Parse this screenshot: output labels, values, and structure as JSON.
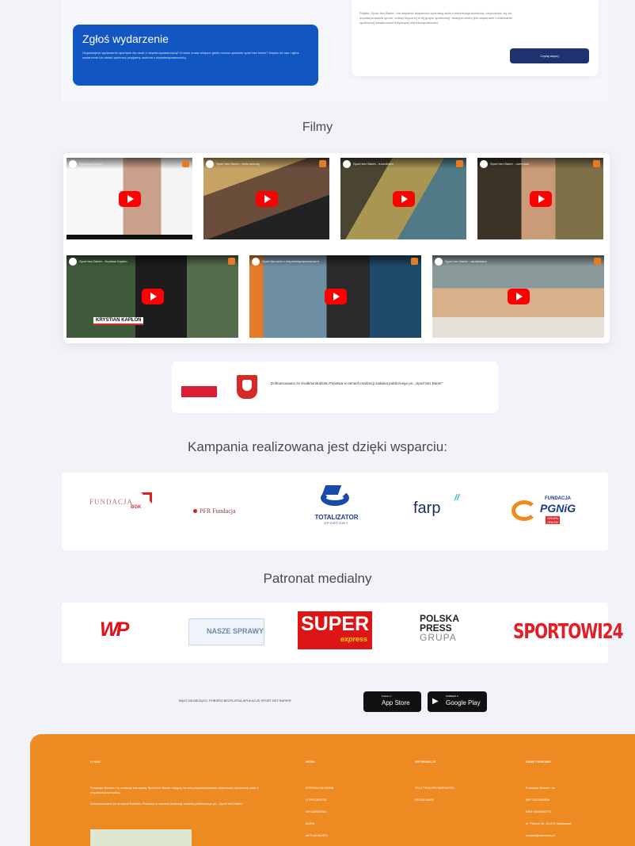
{
  "report_event": {
    "title": "Zgłoś wydarzenie",
    "text": "Organizujesz wydarzenie sportowe dla osób z niepełnosprawnością? A może znasz miejsce gdzie można uprawiać sport bez barier? Napisz do nas i zgłoś wydarzenie lub obiekt sportowy przyjazny osobom z niepełnosprawnością."
  },
  "project_info": {
    "text": "Projekt „Sport bez Barier\" ma wspierać aktywność sportową osób z niepełnosprawnością, przyczyniać się do popularyzowania sportu, kultury fizycznej w tej grupie społecznej. Naszym celem jest wspieranie i budowanie społecznej świadomości dotyczącej niepełnosprawności.",
    "button": "Czytaj więcej"
  },
  "films": {
    "title": "Filmy",
    "videos": [
      {
        "title": "Sport bez Barier",
        "icon": "play-button-icon"
      },
      {
        "title": "Sport bez Barier - tenis stołowy",
        "icon": "play-button-icon"
      },
      {
        "title": "Sport bez Barier - łucznictwo",
        "icon": "play-button-icon"
      },
      {
        "title": "Sport bez Barier - rozmowa",
        "icon": "play-button-icon"
      },
      {
        "title": "Sport bez Barier - Krystian Kapłon",
        "icon": "play-button-icon",
        "caption": "KRYSTIAN KAPŁON"
      },
      {
        "title": "Sport dla osób z niepełnosprawnościami",
        "icon": "play-button-icon"
      },
      {
        "title": "Sport bez Barier - wioślarstwo",
        "icon": "play-button-icon"
      }
    ]
  },
  "funding": {
    "text": "Dofinansowano ze środków Budżetu Państwa w ramach realizacji zadania publicznego pn. „Sport bez Barier\""
  },
  "sponsors": {
    "title": "Kampania realizowana jest dzięki wsparciu:",
    "items": [
      {
        "name": "Fundacja BGK",
        "line1": "FUNDACJA",
        "line2": "BGK"
      },
      {
        "name": "PFR Fundacja",
        "line1": "PFR Fundacja"
      },
      {
        "name": "Totalizator Sportowy",
        "line1": "TOTALIZATOR",
        "line2": "SPORTOWY"
      },
      {
        "name": "farp",
        "line1": "farp"
      },
      {
        "name": "Fundacja PGNiG",
        "line1": "FUNDACJA",
        "line2": "PGNiG",
        "line3": "GRUPA ORLEN"
      }
    ]
  },
  "media": {
    "title": "Patronat medialny",
    "items": [
      {
        "name": "WP",
        "text": "WP"
      },
      {
        "name": "Nasze Sprawy",
        "text": "NASZE SPRAWY"
      },
      {
        "name": "Super Express",
        "line1": "SUPER",
        "line2": "express"
      },
      {
        "name": "Polska Press Grupa",
        "line1": "POLSKA",
        "line2": "PRESS",
        "line3": "GRUPA"
      },
      {
        "name": "Sportowi24",
        "text": "SPORTOWI24"
      }
    ]
  },
  "app_promo": {
    "text": "BĄDŹ NA BIEŻĄCO, POBIERZ BEZPŁATNĄ APLIKACJĘ SPORT BEZ BARIER",
    "app_store_small": "Pobierz z",
    "app_store": "App Store",
    "google_play_small": "POBIERZ Z",
    "google_play": "Google Play"
  },
  "footer": {
    "col1_title": "O NAS",
    "col1_text1": "Fundacja Nomen i In realizuje kampanię Sport bez Barier mającą na celu popularyzowanie aktywności sportowej osób z niepełnosprawnością.",
    "col1_text2": "Dofinansowano ze środków Budżetu Państwa w ramach realizacji zadania publicznego pn. „Sport bez Barier\".",
    "col2_title": "MENU",
    "menu": [
      "STRONA GŁÓWNA",
      "O PROJEKCIE",
      "WYDARZENIA",
      "MAPA",
      "AKTUALNOŚCI"
    ],
    "col3_title": "INFORMACJE",
    "info": [
      "POLITYKA PRYWATNOŚCI",
      "REGULAMIN"
    ],
    "col4_title": "DANE FIRMOWE",
    "company": [
      "Fundacja Nomen i In",
      "NIP 7010263456",
      "KRS 0000655773",
      "ul. Piękna 49, 00-672 Warszawa",
      "kontakt@nomenin.pl"
    ]
  },
  "colors": {
    "report_blue": "#1256c2",
    "button_navy": "#1e3270",
    "footer_orange": "#ee8a22",
    "youtube_red": "#ff0000"
  }
}
